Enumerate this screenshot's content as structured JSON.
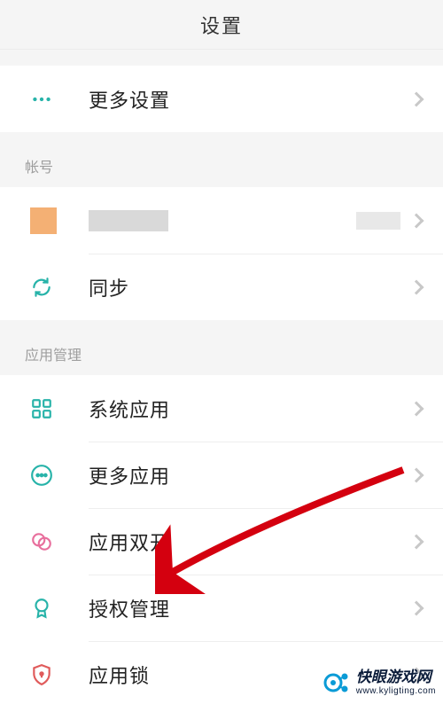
{
  "header": {
    "title": "设置"
  },
  "group1": {
    "items": [
      {
        "label": "更多设置"
      }
    ]
  },
  "account": {
    "header": "帐号",
    "items": [
      {
        "label": "",
        "is_profile": true
      },
      {
        "label": "同步"
      }
    ]
  },
  "apps": {
    "header": "应用管理",
    "items": [
      {
        "label": "系统应用"
      },
      {
        "label": "更多应用"
      },
      {
        "label": "应用双开"
      },
      {
        "label": "授权管理"
      },
      {
        "label": "应用锁"
      }
    ]
  },
  "watermark": {
    "title": "快眼游戏网",
    "url": "www.kyligting.com"
  },
  "colors": {
    "accent_teal": "#27b3a9",
    "accent_orange": "#f4b074",
    "accent_pink": "#e86f9d",
    "accent_red": "#e05b5b",
    "arrow": "#d4000f"
  }
}
